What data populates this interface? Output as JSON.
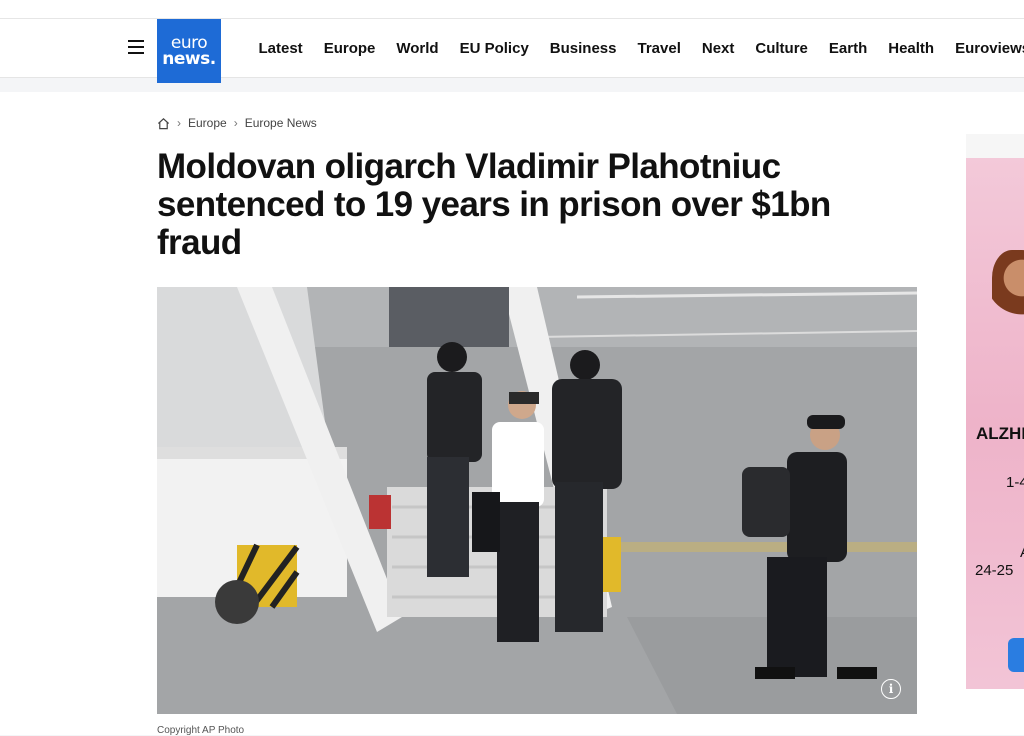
{
  "header": {
    "logo_line1": "euro",
    "logo_line2": "news.",
    "nav": [
      "Latest",
      "Europe",
      "World",
      "EU Policy",
      "Business",
      "Travel",
      "Next",
      "Culture",
      "Earth",
      "Health",
      "Euroviews"
    ]
  },
  "breadcrumb": {
    "items": [
      "Europe",
      "Europe News"
    ]
  },
  "article": {
    "title": "Moldovan oligarch Vladimir Plahotniuc sentenced to 19 years in prison over $1bn fraud",
    "photo_caption": "Copyright AP Photo"
  },
  "ad": {
    "title": "ALZHE",
    "line1": "1-4",
    "line2": "A",
    "line3": "24-25"
  },
  "colors": {
    "brand": "#1e6bd6",
    "ad_background": "#f0bfd3"
  }
}
